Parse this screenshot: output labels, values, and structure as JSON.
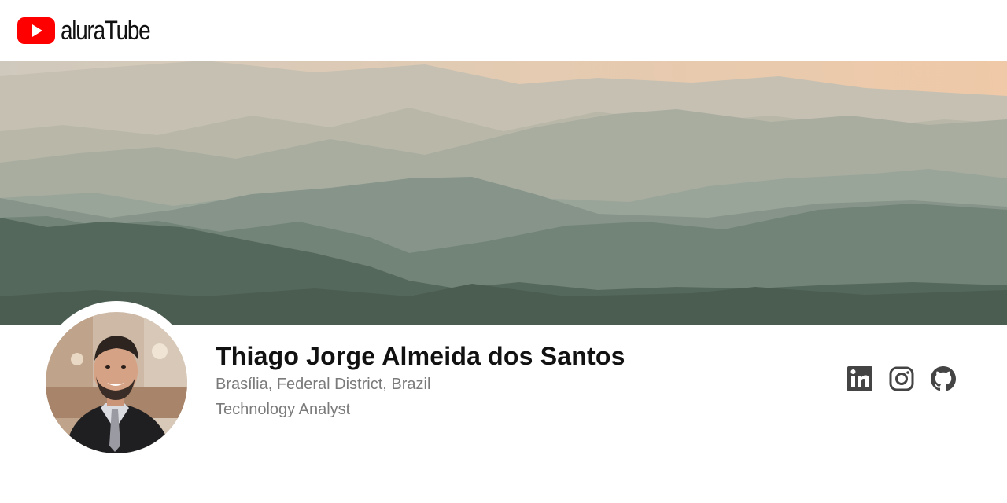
{
  "brand": {
    "name": "aluraTube",
    "logo_color": "#ff0000",
    "logo_icon": "play-icon"
  },
  "banner": {
    "description_icon": "mountains-banner-image"
  },
  "profile": {
    "name": "Thiago Jorge Almeida dos Santos",
    "location": "Brasília, Federal District, Brazil",
    "role": "Technology Analyst",
    "avatar_icon": "profile-photo-avatar"
  },
  "social": [
    {
      "icon": "linkedin-icon"
    },
    {
      "icon": "instagram-icon"
    },
    {
      "icon": "github-icon"
    }
  ],
  "colors": {
    "text_primary": "#111111",
    "text_secondary": "#7a7a7a",
    "icon_gray": "#444444"
  }
}
